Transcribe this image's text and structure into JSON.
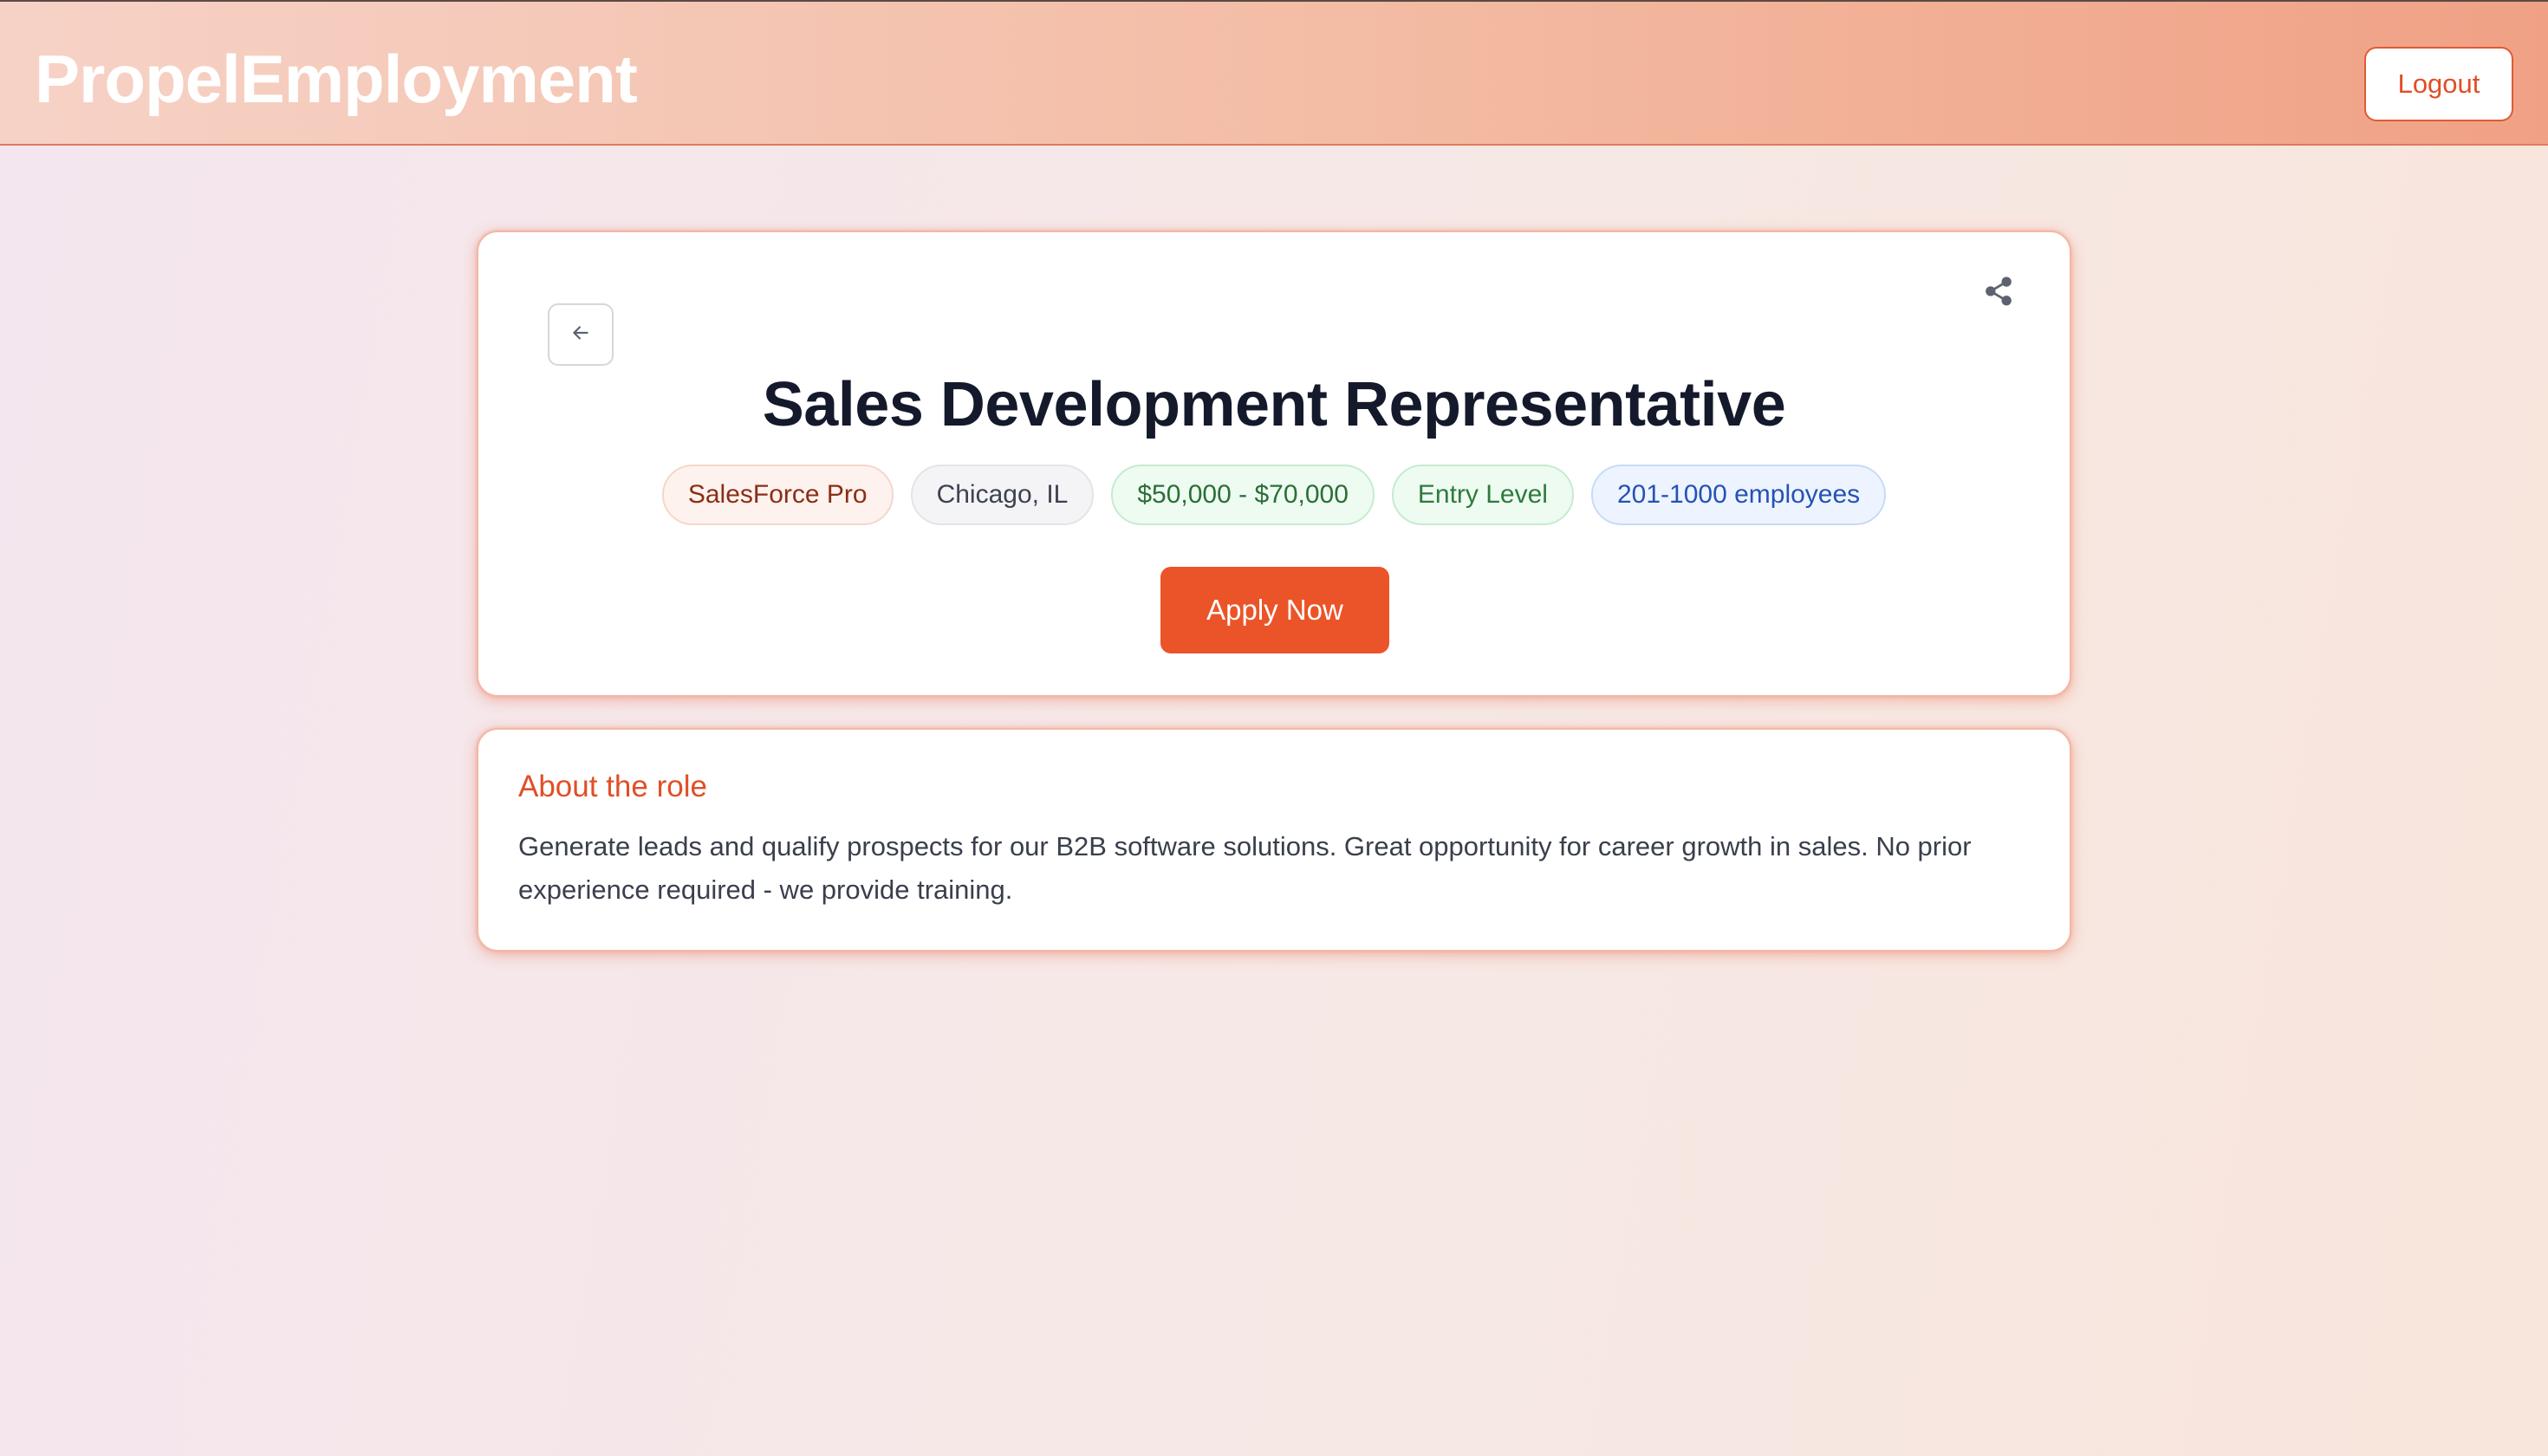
{
  "header": {
    "brand": "PropelEmployment",
    "logout_label": "Logout"
  },
  "job": {
    "title": "Sales Development Representative",
    "tags": {
      "company": "SalesForce Pro",
      "location": "Chicago, IL",
      "salary": "$50,000 - $70,000",
      "level": "Entry Level",
      "company_size": "201-1000 employees"
    },
    "apply_label": "Apply Now",
    "icons": {
      "back": "arrow-left-icon",
      "share": "share-icon"
    }
  },
  "about": {
    "heading": "About the role",
    "description": "Generate leads and qualify prospects for our B2B software solutions. Great opportunity for career growth in sales. No prior experience required - we provide training."
  },
  "colors": {
    "accent": "#eb5428",
    "title": "#141a2b",
    "about_heading": "#e04f26"
  }
}
